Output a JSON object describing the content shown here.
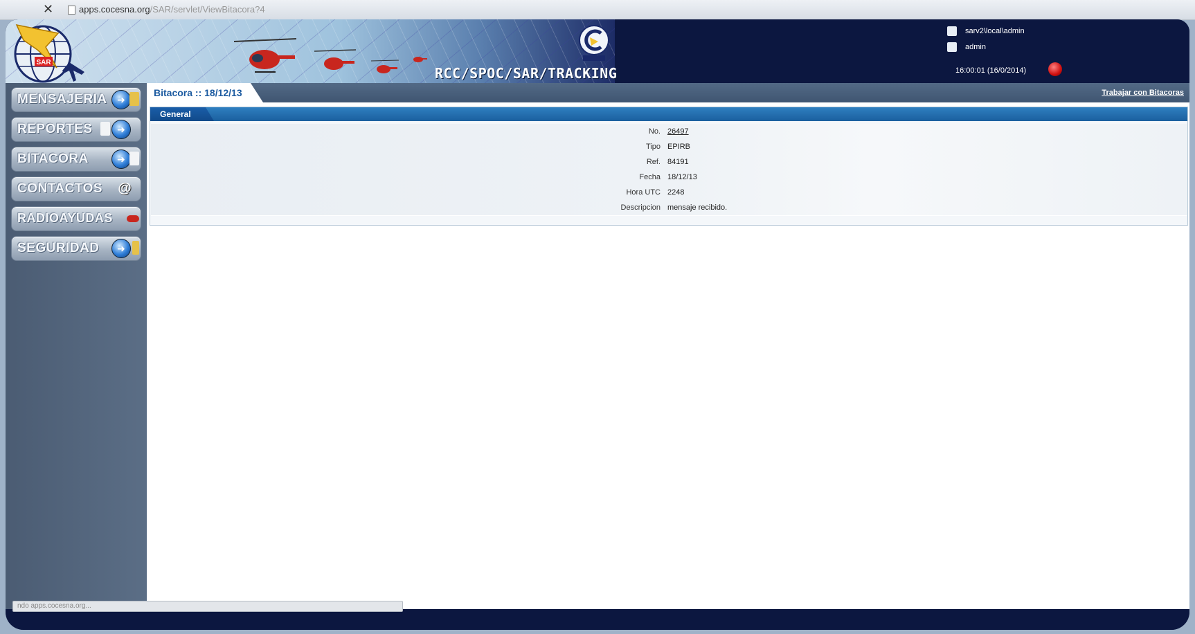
{
  "browser": {
    "url_host": "apps.cocesna.org",
    "url_path": "/SAR/servlet/ViewBitacora?4"
  },
  "header": {
    "app_title": "RCC/SPOC/SAR/TRACKING",
    "user_path": "sarv2\\local\\admin",
    "user_name": "admin",
    "clock": "16:00:01 (16/0/2014)"
  },
  "sidebar": {
    "items": [
      {
        "label": "MENSAJERIA"
      },
      {
        "label": "REPORTES"
      },
      {
        "label": "BITACORA"
      },
      {
        "label": "CONTACTOS"
      },
      {
        "label": "RADIOAYUDAS"
      },
      {
        "label": "SEGURIDAD"
      }
    ]
  },
  "main": {
    "title": "Bitacora :: 18/12/13",
    "link": "Trabajar con Bitacoras",
    "section_title": "General",
    "fields": [
      {
        "label": "No.",
        "value": "26497"
      },
      {
        "label": "Tipo",
        "value": "EPIRB"
      },
      {
        "label": "Ref.",
        "value": "84191"
      },
      {
        "label": "Fecha",
        "value": "18/12/13"
      },
      {
        "label": "Hora UTC",
        "value": "2248"
      },
      {
        "label": "Descripcion",
        "value": "mensaje recibido."
      }
    ]
  },
  "status": {
    "text": "ndo apps.cocesna.org..."
  },
  "colors": {
    "header_bg": "#0c1740",
    "sidebar_bg": "#55677e",
    "accent_blue": "#1b5aa0"
  }
}
